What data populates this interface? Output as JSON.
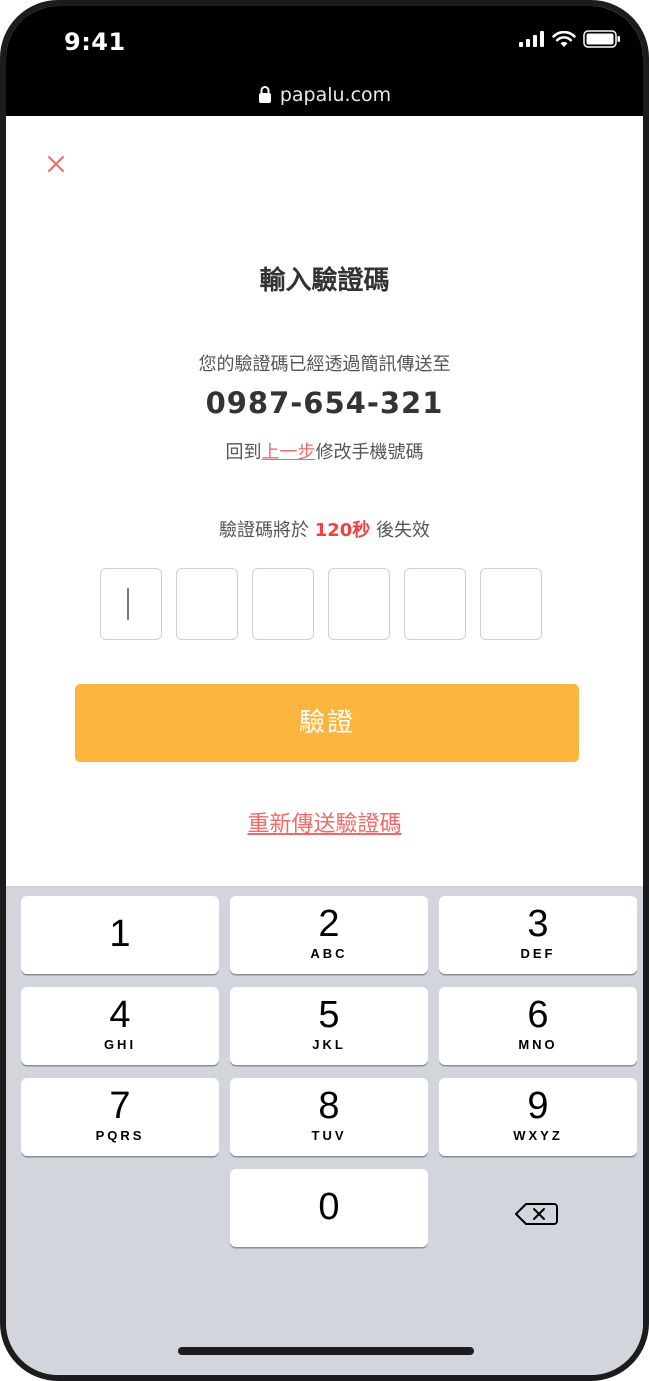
{
  "status_bar": {
    "time": "9:41"
  },
  "browser": {
    "url": "papalu.com"
  },
  "icons": {
    "close": "close-icon",
    "lock": "lock-icon",
    "signal": "signal-icon",
    "wifi": "wifi-icon",
    "battery": "battery-icon",
    "backspace": "backspace-icon"
  },
  "colors": {
    "accent": "#fcb53e",
    "link": "#f06a6a",
    "countdown": "#f04040"
  },
  "page": {
    "title": "輸入驗證碼",
    "sent_text": "您的驗證碼已經透過簡訊傳送至",
    "phone_number": "0987-654-321",
    "back_prefix": "回到",
    "back_link": "上一步",
    "back_suffix": "修改手機號碼",
    "expire_prefix": "驗證碼將於 ",
    "expire_seconds": "120秒",
    "expire_suffix": " 後失效",
    "code_values": [
      "",
      "",
      "",
      "",
      "",
      ""
    ],
    "verify_button": "驗證",
    "resend_link": "重新傳送驗證碼"
  },
  "keypad": {
    "keys": [
      {
        "digit": "1",
        "letters": ""
      },
      {
        "digit": "2",
        "letters": "ABC"
      },
      {
        "digit": "3",
        "letters": "DEF"
      },
      {
        "digit": "4",
        "letters": "GHI"
      },
      {
        "digit": "5",
        "letters": "JKL"
      },
      {
        "digit": "6",
        "letters": "MNO"
      },
      {
        "digit": "7",
        "letters": "PQRS"
      },
      {
        "digit": "8",
        "letters": "TUV"
      },
      {
        "digit": "9",
        "letters": "WXYZ"
      },
      {
        "digit": "0",
        "letters": ""
      }
    ]
  }
}
